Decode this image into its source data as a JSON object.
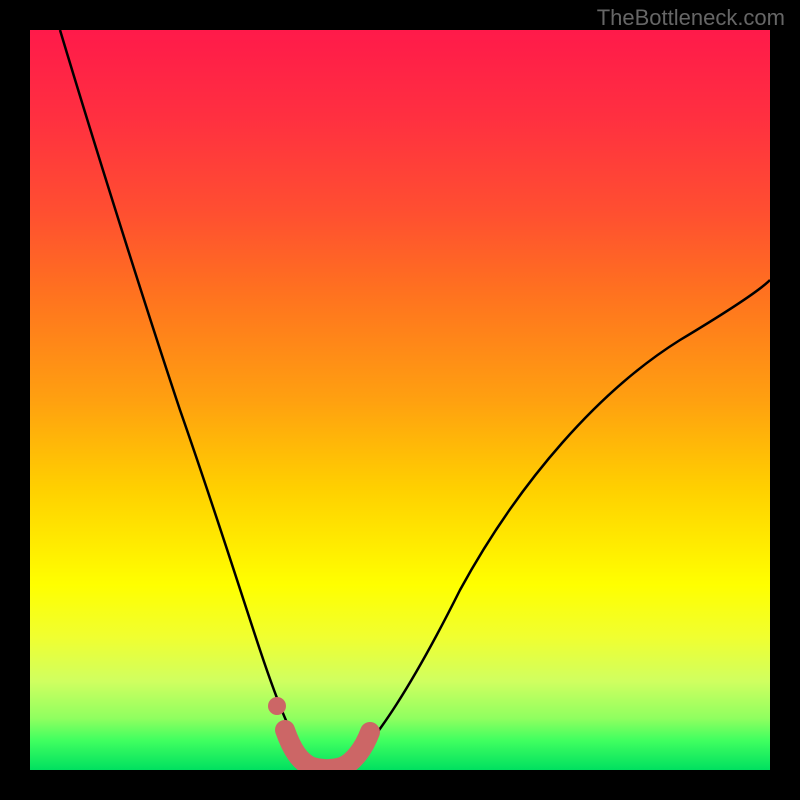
{
  "watermark": "TheBottleneck.com",
  "chart_data": {
    "type": "line",
    "title": "",
    "xlabel": "",
    "ylabel": "",
    "xlim": [
      0,
      100
    ],
    "ylim": [
      0,
      100
    ],
    "series": [
      {
        "name": "bottleneck-curve",
        "x": [
          4,
          10,
          15,
          20,
          24,
          27,
          30,
          32,
          34,
          36,
          38,
          40,
          42,
          44,
          48,
          54,
          62,
          72,
          84,
          100
        ],
        "y": [
          100,
          83,
          70,
          57,
          44,
          33,
          22,
          14,
          7,
          3,
          1,
          0,
          1,
          3,
          10,
          22,
          36,
          48,
          58,
          67
        ]
      }
    ],
    "highlight": {
      "name": "optimal-zone",
      "x": [
        33.5,
        35,
        37,
        39,
        41,
        43,
        45
      ],
      "y": [
        8.5,
        3,
        1,
        0,
        0,
        1,
        4
      ]
    },
    "gradient_stops": [
      {
        "pos": 0,
        "color": "#ff1a4a"
      },
      {
        "pos": 50,
        "color": "#ffd000"
      },
      {
        "pos": 75,
        "color": "#ffff00"
      },
      {
        "pos": 100,
        "color": "#00e060"
      }
    ]
  }
}
